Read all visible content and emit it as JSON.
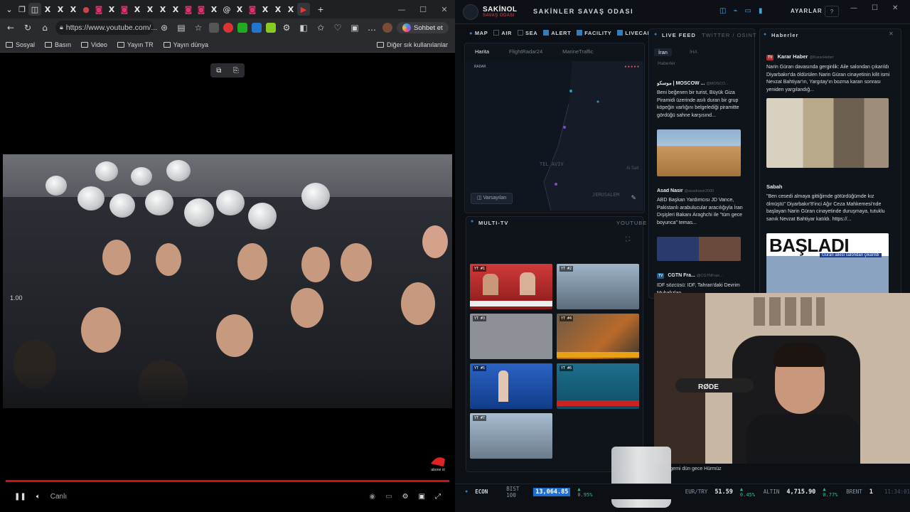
{
  "browser": {
    "tabs": [
      "X",
      "X",
      "X",
      "X",
      "Instagram",
      "X",
      "Instagram",
      "X",
      "X",
      "X",
      "X",
      "Instagram",
      "Instagram",
      "X",
      "Instagram",
      "X",
      "X",
      "X",
      "YouTube"
    ],
    "new_tab": "+",
    "url": "https://www.youtube.com/...",
    "chat_button": "Sohbet et",
    "bookmarks": [
      "Sosyal",
      "Basın",
      "Video",
      "Yayın TR",
      "Yayın dünya"
    ],
    "other_bookmarks": "Diğer sık kullanılanlar",
    "video": {
      "speed_overlay": "1.00",
      "live_label": "Canlı",
      "progress": 1.0,
      "channel_logo": "abone ol"
    }
  },
  "dashboard": {
    "brand": "SAKİNOL",
    "brand_sub": "SAVAŞ ODASI",
    "room_title": "SAKİNLER SAVAŞ ODASI",
    "settings": "AYARLAR",
    "help": "?",
    "layers": [
      {
        "label": "MAP",
        "checked": true
      },
      {
        "label": "AIR",
        "checked": false
      },
      {
        "label": "SEA",
        "checked": false
      },
      {
        "label": "ALERT",
        "checked": true
      },
      {
        "label": "FACILITY",
        "checked": true
      },
      {
        "label": "LIVECAM",
        "checked": true
      }
    ],
    "map_tabs": [
      "Harita",
      "FlightRadar24",
      "MarineTraffic"
    ],
    "map": {
      "radar_label": "RADAR",
      "places": [
        "TEL AVIV",
        "JERUSALEM",
        "Al Salt"
      ],
      "default_button": "Varsayılan"
    },
    "multitv": {
      "title": "MULTI-TV",
      "source": "YOUTUBE",
      "slots": [
        "YT #1",
        "YT #2",
        "YT #3",
        "YT #4",
        "YT #5",
        "YT #6",
        "YT #7"
      ]
    },
    "live_feed": {
      "title": "LIVE FEED",
      "subtitle": "TWITTER / OSINT",
      "tabs": [
        "İran",
        "İHA",
        "Haberler"
      ],
      "items": [
        {
          "author": "موسكو | MOSCOW ...",
          "handle": "@MOSCO...",
          "text": "Beni beğenen bir turist, Büyük Giza Piramidi üzerinde asılı duran bir grup köpeğin varlığını belgelediği piramitte gördüğü sahne karşısınd..."
        },
        {
          "author": "Asad Nasir",
          "handle": "@asadnasir2000",
          "text": "ABD Başkan Yardımcısı JD Vance, Pakistanlı arabulucular aracılığıyla İran Dışişleri Bakanı Araghchi ile \"tüm gece boyunca\" temas..."
        },
        {
          "author": "CGTN Fra...",
          "handle": "@CGTNFran...",
          "text": "IDF sözcüsü: IDF, Tahran'daki Devrim Muhafızları..."
        }
      ]
    },
    "news": {
      "title": "Haberler",
      "items": [
        {
          "author": "Karar Haber",
          "handle": "@KararHaber",
          "text": "Narin Güran davasında gerginlik: Aile salondan çıkarıldı Diyarbakır'da öldürülen Narin Güran cinayetinin kilit ismi Nevzat Bahtiyar'ın, Yargıtay'ın bozma kararı sonrası yeniden yargılandığ..."
        },
        {
          "author": "Sabah",
          "handle": "",
          "text": "\"Ben cesedi almaya gittiğimde götürdüğümde kız ölmüştü\" Diyarbakır'8'inci Ağır Ceza Mahkemesi'nde başlayan Narin Güran cinayetinde duruşmaya, tutuklu sanık Nevzat Bahtiyar katıldı. https://..."
        }
      ],
      "headline": "BAŞLADI",
      "headline_sub": "Güran ailesi salondan çıkarıldı"
    },
    "caption": "ahipli gemi dün gece Hürmüz",
    "ticker": {
      "label": "ECON",
      "items": [
        {
          "name": "BIST 100",
          "value": "13,064.85",
          "change": "▲ 0.95%"
        },
        {
          "name": "EUR/TRY",
          "value": "51.59",
          "change": "▲ 0.45%"
        },
        {
          "name": "ALTIN",
          "value": "4,715.90",
          "change": "▲ 0.77%"
        },
        {
          "name": "BRENT",
          "value": "1",
          "change": ""
        }
      ],
      "time": "11:34:01"
    },
    "colors": {
      "accent": "#2f7ec0",
      "up": "#26c281",
      "alert": "#d9534f",
      "bg": "#0c1015"
    }
  }
}
